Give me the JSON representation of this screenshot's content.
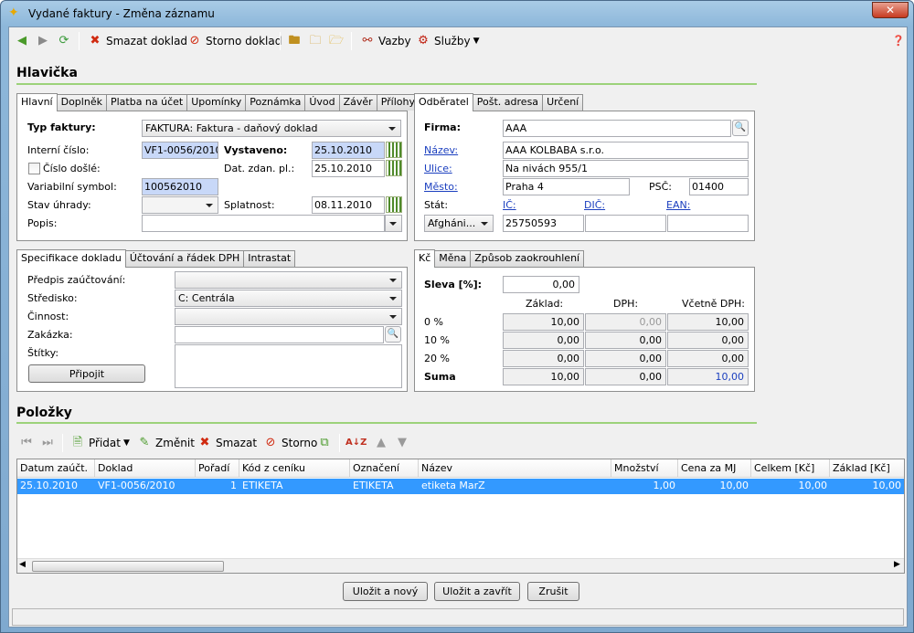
{
  "window": {
    "title": "Vydané faktury - Změna záznamu"
  },
  "toolbar": {
    "delete": "Smazat doklad",
    "storno": "Storno doklad",
    "links": "Vazby",
    "services": "Služby"
  },
  "header": {
    "title": "Hlavička"
  },
  "main_tabs": [
    "Hlavní",
    "Doplněk",
    "Platba na účet",
    "Upomínky",
    "Poznámka",
    "Úvod",
    "Závěr",
    "Přílohy"
  ],
  "main": {
    "type_label": "Typ faktury:",
    "type_value": "FAKTURA: Faktura - daňový doklad",
    "internal_label": "Interní číslo:",
    "internal_value": "VF1-0056/2010",
    "issued_label": "Vystaveno:",
    "issued_value": "25.10.2010",
    "incoming_label": "Číslo došlé:",
    "taxdate_label": "Dat. zdan. pl.:",
    "taxdate_value": "25.10.2010",
    "varsym_label": "Variabilní symbol:",
    "varsym_value": "100562010",
    "paystate_label": "Stav úhrady:",
    "due_label": "Splatnost:",
    "due_value": "08.11.2010",
    "desc_label": "Popis:"
  },
  "partner_tabs": [
    "Odběratel",
    "Pošt. adresa",
    "Určení"
  ],
  "partner": {
    "firm_label": "Firma:",
    "firm_value": "AAA",
    "name_label": "Název:",
    "name_value": "AAA KOLBABA s.r.o.",
    "street_label": "Ulice:",
    "street_value": "Na nivách 955/1",
    "city_label": "Město:",
    "city_value": "Praha 4",
    "zip_label": "PSČ:",
    "zip_value": "01400",
    "state_label": "Stát:",
    "state_value": "Afgháni...",
    "ic_label": "IČ:",
    "ic_value": "25750593",
    "dic_label": "DIČ:",
    "ean_label": "EAN:"
  },
  "spec_tabs": [
    "Specifikace dokladu",
    "Účtování a řádek DPH",
    "Intrastat"
  ],
  "spec": {
    "predpis_label": "Předpis zaúčtování:",
    "center_label": "Středisko:",
    "center_value": "C: Centrála",
    "activity_label": "Činnost:",
    "order_label": "Zakázka:",
    "tags_label": "Štítky:",
    "attach_button": "Připojit"
  },
  "money_tabs": [
    "Kč",
    "Měna",
    "Způsob zaokrouhlení"
  ],
  "money": {
    "discount_label": "Sleva [%]:",
    "discount_value": "0,00",
    "col_base": "Základ:",
    "col_vat": "DPH:",
    "col_total": "Včetně DPH:",
    "rows": [
      {
        "label": "0 %",
        "base": "10,00",
        "vat": "0,00",
        "total": "10,00"
      },
      {
        "label": "10 %",
        "base": "0,00",
        "vat": "0,00",
        "total": "0,00"
      },
      {
        "label": "20 %",
        "base": "0,00",
        "vat": "0,00",
        "total": "0,00"
      },
      {
        "label": "Suma",
        "base": "10,00",
        "vat": "0,00",
        "total": "10,00"
      }
    ]
  },
  "items": {
    "title": "Položky",
    "add": "Přidat",
    "change": "Změnit",
    "delete": "Smazat",
    "storno": "Storno"
  },
  "grid": {
    "columns": [
      "Datum zaúčt.",
      "Doklad",
      "Pořadí",
      "Kód z ceníku",
      "Označení",
      "Název",
      "Množství",
      "Cena za MJ",
      "Celkem [Kč]",
      "Základ [Kč]"
    ],
    "row": [
      "25.10.2010",
      "VF1-0056/2010",
      "1",
      "ETIKETA",
      "ETIKETA",
      "etiketa MarZ",
      "1,00",
      "10,00",
      "10,00",
      "10,00"
    ]
  },
  "buttons": {
    "save_new": "Uložit a nový",
    "save_close": "Uložit a zavřít",
    "cancel": "Zrušit"
  },
  "colors": {
    "accent_rule": "#9cd27a",
    "selection": "#3399ff",
    "link": "#1b3fbf"
  }
}
